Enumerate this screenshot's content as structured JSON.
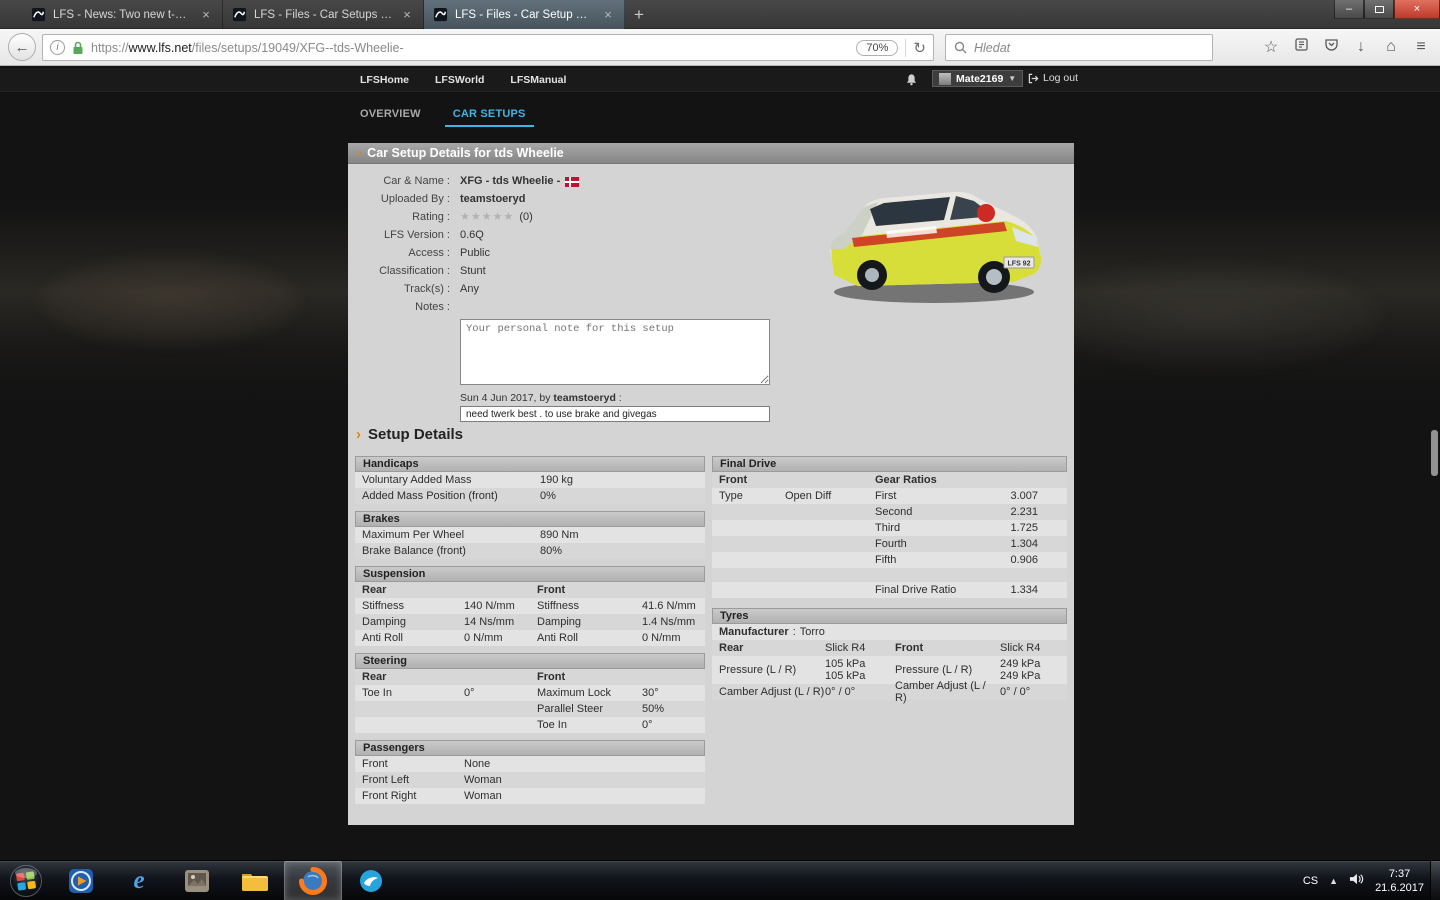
{
  "browser": {
    "tabs": [
      {
        "title": "LFS - News: Two new t-shirts"
      },
      {
        "title": "LFS - Files - Car Setups Listing"
      },
      {
        "title": "LFS - Files - Car Setup Detail"
      }
    ],
    "url_scheme": "https://",
    "url_domain": "www.lfs.net",
    "url_path": "/files/setups/19049/XFG--tds-Wheelie-",
    "zoom_badge": "70%",
    "search_placeholder": "Hledat"
  },
  "icons": {
    "close": "×",
    "new_tab": "+",
    "win_min": "–",
    "back": "←",
    "reload": "↻",
    "info": "i",
    "star": "☆",
    "download": "↓",
    "home": "⌂",
    "menu": "≡",
    "caret_down": "▼",
    "tray_up": "▲",
    "arrow": "›",
    "ie_letter": "e"
  },
  "site_header": {
    "nav": [
      {
        "label": "LFSHome"
      },
      {
        "label": "LFSWorld"
      },
      {
        "label": "LFSManual"
      }
    ],
    "username": "Mate2169",
    "logout": "Log out"
  },
  "page_tabs": [
    {
      "label": "OVERVIEW"
    },
    {
      "label": "CAR SETUPS"
    }
  ],
  "setup_page": {
    "header_title": "Car Setup Details for tds Wheelie",
    "details": {
      "car_name_label": "Car & Name :",
      "car_name": "XFG - tds Wheelie -",
      "uploaded_label": "Uploaded By :",
      "uploaded_by": "teamstoeryd",
      "rating_label": "Rating :",
      "rating_stars": "★★★★★",
      "rating_count": "(0)",
      "version_label": "LFS Version :",
      "version": "0.6Q",
      "access_label": "Access :",
      "access": "Public",
      "classification_label": "Classification :",
      "classification": "Stunt",
      "tracks_label": "Track(s) :",
      "tracks": "Any",
      "notes_label": "Notes :",
      "notes_placeholder": "Your personal note for this setup",
      "comment_date": "Sun 4 Jun 2017, by",
      "comment_author": "teamstoeryd",
      "comment_suffix": ":",
      "comment_text": "need twerk best . to use brake and givegas",
      "car_plate": "LFS 92"
    },
    "setup_title": "Setup Details",
    "handicaps": {
      "title": "Handicaps",
      "rows": [
        {
          "label": "Voluntary Added Mass",
          "value": "190 kg"
        },
        {
          "label": "Added Mass Position (front)",
          "value": "0%"
        }
      ]
    },
    "brakes": {
      "title": "Brakes",
      "rows": [
        {
          "label": "Maximum Per Wheel",
          "value": "890 Nm"
        },
        {
          "label": "Brake Balance (front)",
          "value": "80%"
        }
      ]
    },
    "suspension": {
      "title": "Suspension",
      "sub_left": "Rear",
      "sub_right": "Front",
      "rows": [
        {
          "rl": "Stiffness",
          "rv": "140 N/mm",
          "fl": "Stiffness",
          "fv": "41.6 N/mm"
        },
        {
          "rl": "Damping",
          "rv": "14 Ns/mm",
          "fl": "Damping",
          "fv": "1.4 Ns/mm"
        },
        {
          "rl": "Anti Roll",
          "rv": "0 N/mm",
          "fl": "Anti Roll",
          "fv": "0 N/mm"
        }
      ]
    },
    "steering": {
      "title": "Steering",
      "sub_left": "Rear",
      "sub_right": "Front",
      "rows": [
        {
          "rl": "Toe In",
          "rv": "0°",
          "fl": "Maximum Lock",
          "fv": "30°"
        },
        {
          "rl": "",
          "rv": "",
          "fl": "Parallel Steer",
          "fv": "50%"
        },
        {
          "rl": "",
          "rv": "",
          "fl": "Toe In",
          "fv": "0°"
        }
      ]
    },
    "passengers": {
      "title": "Passengers",
      "rows": [
        {
          "label": "Front",
          "value": "None"
        },
        {
          "label": "Front Left",
          "value": "Woman"
        },
        {
          "label": "Front Right",
          "value": "Woman"
        }
      ]
    },
    "final_drive": {
      "title": "Final Drive",
      "sub_left": "Front",
      "sub_right": "Gear Ratios",
      "type_label": "Type",
      "type_value": "Open Diff",
      "gears": [
        {
          "name": "First",
          "ratio": "3.007"
        },
        {
          "name": "Second",
          "ratio": "2.231"
        },
        {
          "name": "Third",
          "ratio": "1.725"
        },
        {
          "name": "Fourth",
          "ratio": "1.304"
        },
        {
          "name": "Fifth",
          "ratio": "0.906"
        }
      ],
      "final_label": "Final Drive Ratio",
      "final_ratio": "1.334"
    },
    "tyres": {
      "title": "Tyres",
      "manufacturer_label": "Manufacturer",
      "manufacturer_sep": ":",
      "manufacturer": "Torro",
      "rear_label": "Rear",
      "rear_compound": "Slick R4",
      "front_label": "Front",
      "front_compound": "Slick R4",
      "pressure_label": "Pressure (L / R)",
      "rear_pressure_1": "105 kPa",
      "rear_pressure_2": "105 kPa",
      "front_pressure_1": "249 kPa",
      "front_pressure_2": "249 kPa",
      "camber_label": "Camber Adjust (L / R)",
      "rear_camber": "0° / 0°",
      "front_camber": "0° / 0°"
    }
  },
  "taskbar": {
    "language": "CS",
    "time": "7:37",
    "date": "21.6.2017"
  }
}
